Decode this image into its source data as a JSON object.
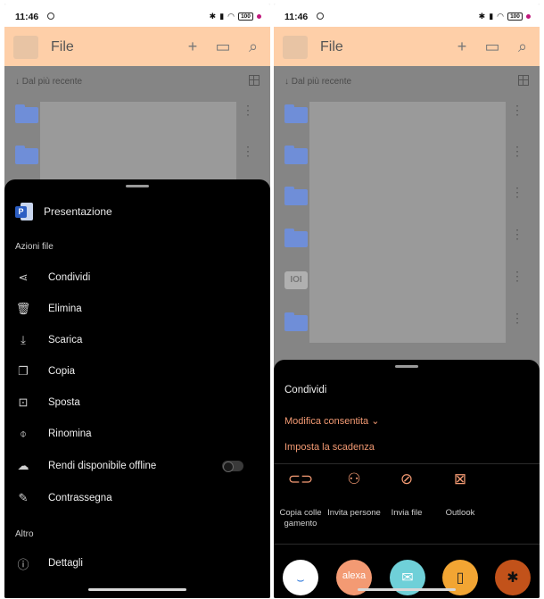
{
  "status": {
    "time": "11:46",
    "battery": "100"
  },
  "header": {
    "title": "File"
  },
  "list": {
    "sort_label": "Dal più recente"
  },
  "left_sheet": {
    "file_name": "Presentazione",
    "section_actions": "Azioni file",
    "items": [
      {
        "icon": "share-icon",
        "label": "Condividi"
      },
      {
        "icon": "trash-icon",
        "label": "Elimina"
      },
      {
        "icon": "download-icon",
        "label": "Scarica"
      },
      {
        "icon": "copy-icon",
        "label": "Copia"
      },
      {
        "icon": "move-folder-icon",
        "label": "Sposta"
      },
      {
        "icon": "rename-icon",
        "label": "Rinomina"
      },
      {
        "icon": "cloud-offline-icon",
        "label": "Rendi disponibile offline"
      },
      {
        "icon": "pencil-icon",
        "label": "Contrassegna"
      }
    ],
    "section_other": "Altro",
    "details": {
      "icon": "info-icon",
      "label": "Dettagli"
    },
    "offline_toggle": false
  },
  "right_sheet": {
    "title": "Condividi",
    "permission_link": "Modifica consentita",
    "expiry_link": "Imposta la scadenza",
    "actions": [
      {
        "icon": "link-icon",
        "label": "Copia colle gamento"
      },
      {
        "icon": "invite-people-icon",
        "label": "Invita persone"
      },
      {
        "icon": "paperclip-icon",
        "label": "Invia file"
      },
      {
        "icon": "outlook-icon",
        "label": "Outlook"
      }
    ],
    "apps": [
      {
        "name": "amazon-app-icon",
        "label": "",
        "color": "#ffffff"
      },
      {
        "name": "alexa-app-icon",
        "label": "alexa",
        "color": "#f39a73"
      },
      {
        "name": "mail-app-icon",
        "label": "",
        "color": "#6fd0d8"
      },
      {
        "name": "notes-app-icon",
        "label": "",
        "color": "#f2a533"
      },
      {
        "name": "bluetooth-app-icon",
        "label": "",
        "color": "#c2521a"
      }
    ]
  },
  "colors": {
    "header_bg": "#fecfa8",
    "accent_orange": "#f39a73",
    "sheet_bg": "#000000"
  }
}
